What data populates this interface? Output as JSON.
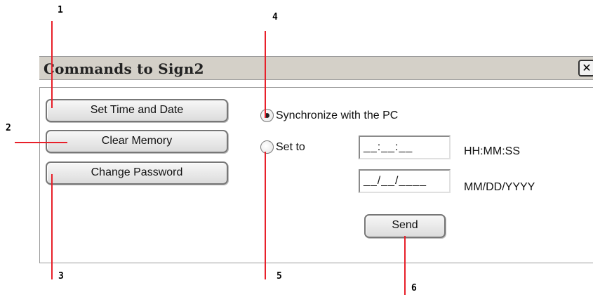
{
  "window": {
    "title": "Commands to Sign2",
    "close_glyph": "✕"
  },
  "buttons": {
    "set_time_date": "Set Time and Date",
    "clear_memory": "Clear Memory",
    "change_password": "Change Password",
    "send": "Send"
  },
  "radios": {
    "sync_pc": {
      "label": "Synchronize with the PC",
      "checked": true
    },
    "set_to": {
      "label": "Set to",
      "checked": false
    }
  },
  "fields": {
    "time": {
      "value": "__:__:__",
      "format": "HH:MM:SS"
    },
    "date": {
      "value": "__/__/____",
      "format": "MM/DD/YYYY"
    }
  },
  "callouts": [
    "1",
    "2",
    "3",
    "4",
    "5",
    "6"
  ],
  "colors": {
    "callout_line": "#e8202a",
    "titlebar": "#d4d0c8"
  }
}
